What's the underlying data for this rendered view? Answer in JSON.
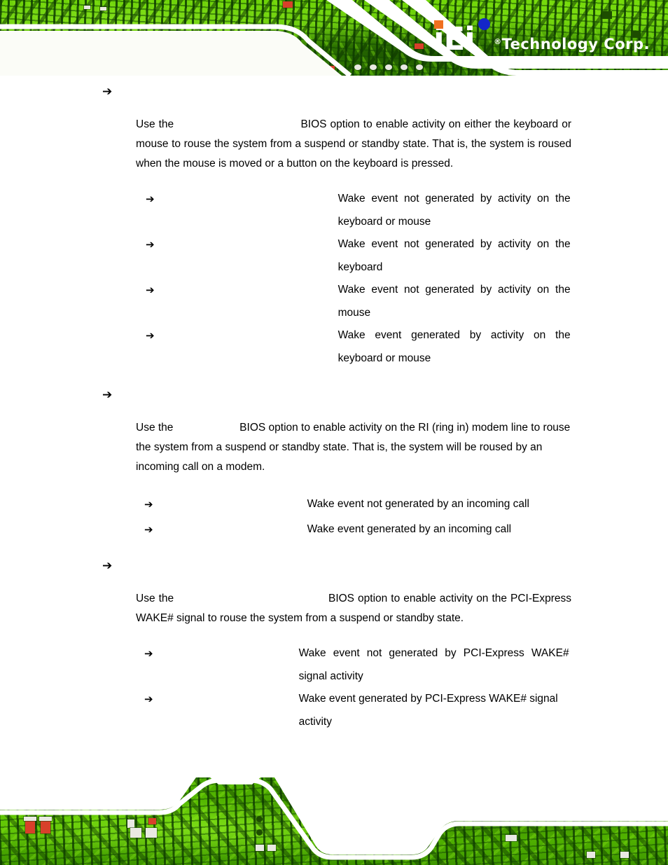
{
  "brand": {
    "logo_letters": "iEi",
    "registered_mark": "®",
    "company_text": "Technology Corp.",
    "company_suffix": ".",
    "colors": {
      "pcb_green": "#5cc400",
      "pcb_dark_green": "#0e3c00",
      "logo_square_orange": "#f07020",
      "logo_dot_blue": "#1426c8",
      "swoosh_white": "#ffffff",
      "body_text": "#000000"
    }
  },
  "icons": {
    "bullet_arrow": "➔"
  },
  "sections": [
    {
      "heading": "",
      "paragraph_before": "Use  the",
      "option_name_inline": "",
      "paragraph_after": "BIOS  option  to  enable  activity  on  either  the keyboard  or  mouse  to  rouse  the  system  from  a  suspend  or  standby  state.  That  is,  the system is roused when the mouse is moved or a button on the keyboard is pressed.",
      "options": [
        {
          "name": "",
          "desc": "Wake  event  not  generated  by  activity  on  the keyboard or mouse"
        },
        {
          "name": "",
          "desc": "Wake  event  not  generated  by  activity  on  the keyboard"
        },
        {
          "name": "",
          "desc": "Wake  event  not  generated  by  activity  on  the mouse"
        },
        {
          "name": "",
          "desc": "Wake  event  generated  by  activity  on  the keyboard or mouse"
        }
      ]
    },
    {
      "heading": "",
      "paragraph_before": "Use the",
      "option_name_inline": "",
      "paragraph_after": "BIOS option to enable activity on the RI (ring in) modem line to rouse the system from a suspend or standby state. That is, the system will be roused by an incoming call on a modem.",
      "options": [
        {
          "name": "",
          "desc": "Wake event not generated by an incoming call"
        },
        {
          "name": "",
          "desc": "Wake event generated by an incoming call"
        }
      ]
    },
    {
      "heading": "",
      "paragraph_before": "Use  the",
      "option_name_inline": "",
      "paragraph_after": "BIOS  option  to  enable  activity  on  the PCI-Express WAKE# signal to rouse the system from a suspend or standby state.",
      "options": [
        {
          "name": "",
          "desc": "Wake  event  not  generated  by  PCI-Express  WAKE# signal activity"
        },
        {
          "name": "",
          "desc": "Wake event generated by PCI-Express WAKE# signal activity"
        }
      ]
    }
  ]
}
